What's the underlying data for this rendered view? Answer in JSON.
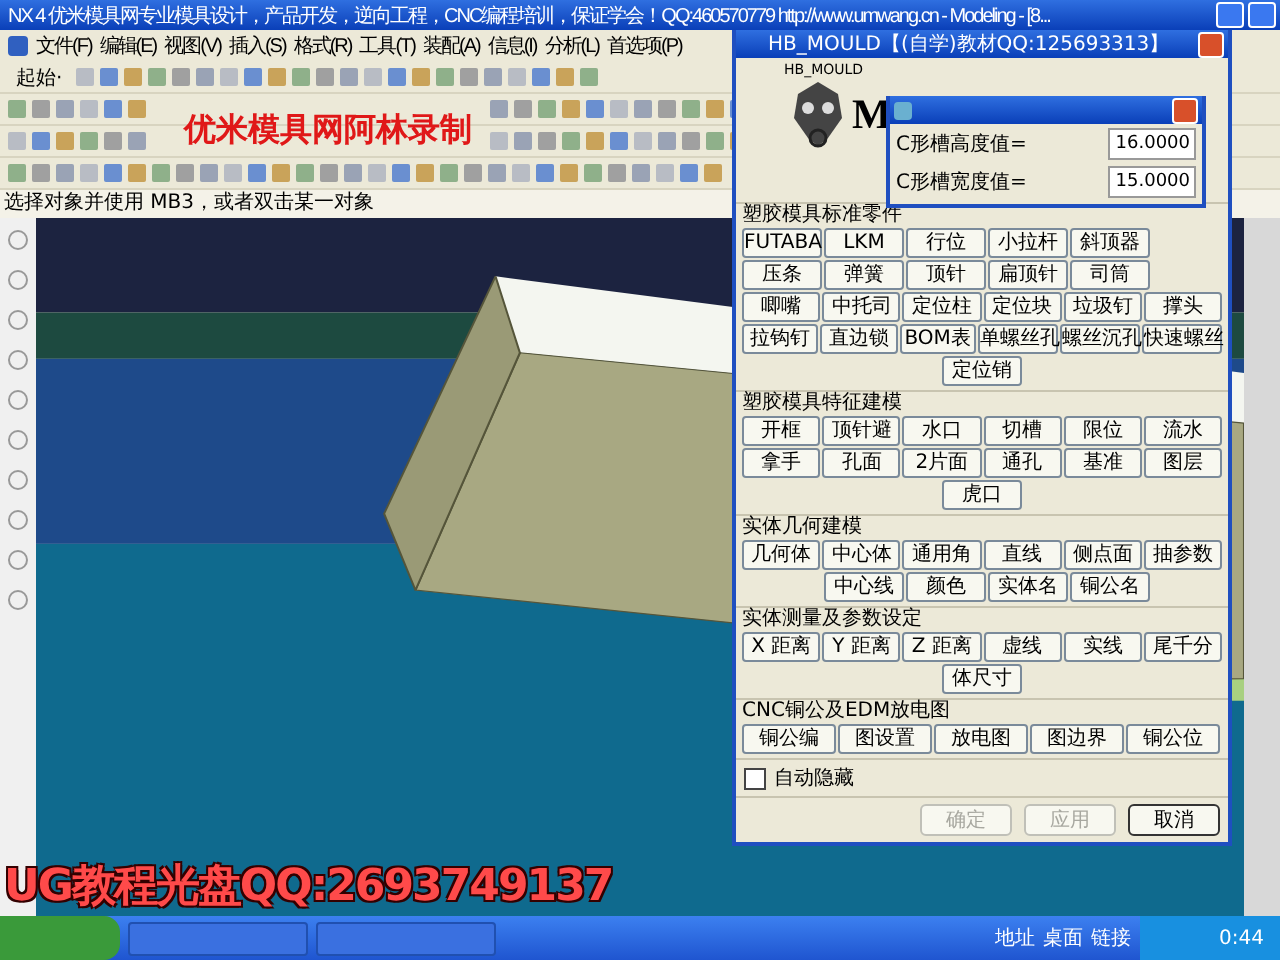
{
  "window": {
    "title": "NX 4 优米模具网专业模具设计，产品开发，逆向工程，CNC编程培训，保证学会！QQ:460570779  http://www.umwang.cn - Modeling - [8..."
  },
  "menu": [
    "文件(F)",
    "编辑(E)",
    "视图(V)",
    "插入(S)",
    "格式(R)",
    "工具(T)",
    "装配(A)",
    "信息(I)",
    "分析(L)",
    "首选项(P)"
  ],
  "toolbar": {
    "start_button": "起始·"
  },
  "status_line": "选择对象并使用 MB3，或者双击某一对象",
  "dialog": {
    "title": "HB_MOULD【(自学)教材QQ:125693313】",
    "label": "HB_MOULD",
    "logo_text": "M",
    "sections": [
      {
        "title": "塑胶模具标准零件",
        "rows": [
          [
            "FUTABA",
            "LKM",
            "行位",
            "小拉杆",
            "斜顶器"
          ],
          [
            "压条",
            "弹簧",
            "顶针",
            "扁顶针",
            "司筒"
          ],
          [
            "唧嘴",
            "中托司",
            "定位柱",
            "定位块",
            "垃圾钉",
            "撑头"
          ],
          [
            "拉钩钉",
            "直边锁",
            "BOM表",
            "单螺丝孔",
            "螺丝沉孔",
            "快速螺丝"
          ],
          [
            "定位销"
          ]
        ]
      },
      {
        "title": "塑胶模具特征建模",
        "rows": [
          [
            "开框",
            "顶针避",
            "水口",
            "切槽",
            "限位",
            "流水"
          ],
          [
            "拿手",
            "孔面",
            "2片面",
            "通孔",
            "基准",
            "图层"
          ],
          [
            "虎口"
          ]
        ]
      },
      {
        "title": "实体几何建模",
        "rows": [
          [
            "几何体",
            "中心体",
            "通用角",
            "直线",
            "侧点面",
            "抽参数"
          ],
          [
            "",
            "中心线",
            "颜色",
            "实体名",
            "铜公名"
          ]
        ]
      },
      {
        "title": "实体测量及参数设定",
        "rows": [
          [
            "X 距离",
            "Y 距离",
            "Z 距离",
            "虚线",
            "实线",
            "尾千分"
          ],
          [
            "体尺寸"
          ]
        ]
      },
      {
        "title": "CNC铜公及EDM放电图",
        "rows": [
          [
            "铜公编",
            "图设置",
            "放电图",
            "图边界",
            "铜公位"
          ]
        ]
      }
    ],
    "auto_hide": {
      "label": "自动隐藏",
      "checked": false
    },
    "buttons": [
      {
        "label": "确定",
        "disabled": true
      },
      {
        "label": "应用",
        "disabled": true
      },
      {
        "label": "取消",
        "disabled": false
      }
    ]
  },
  "popup": {
    "fields": [
      {
        "label": "C形槽高度值=",
        "value": "16.0000"
      },
      {
        "label": "C形槽宽度值=",
        "value": "15.0000"
      }
    ]
  },
  "taskbar": {
    "items": [
      "地址",
      "桌面",
      "链接"
    ],
    "clock": "0:44"
  },
  "overlay_captions": [
    "优米模具网阿林录制",
    "UG教程光盘QQ:2693749137"
  ]
}
